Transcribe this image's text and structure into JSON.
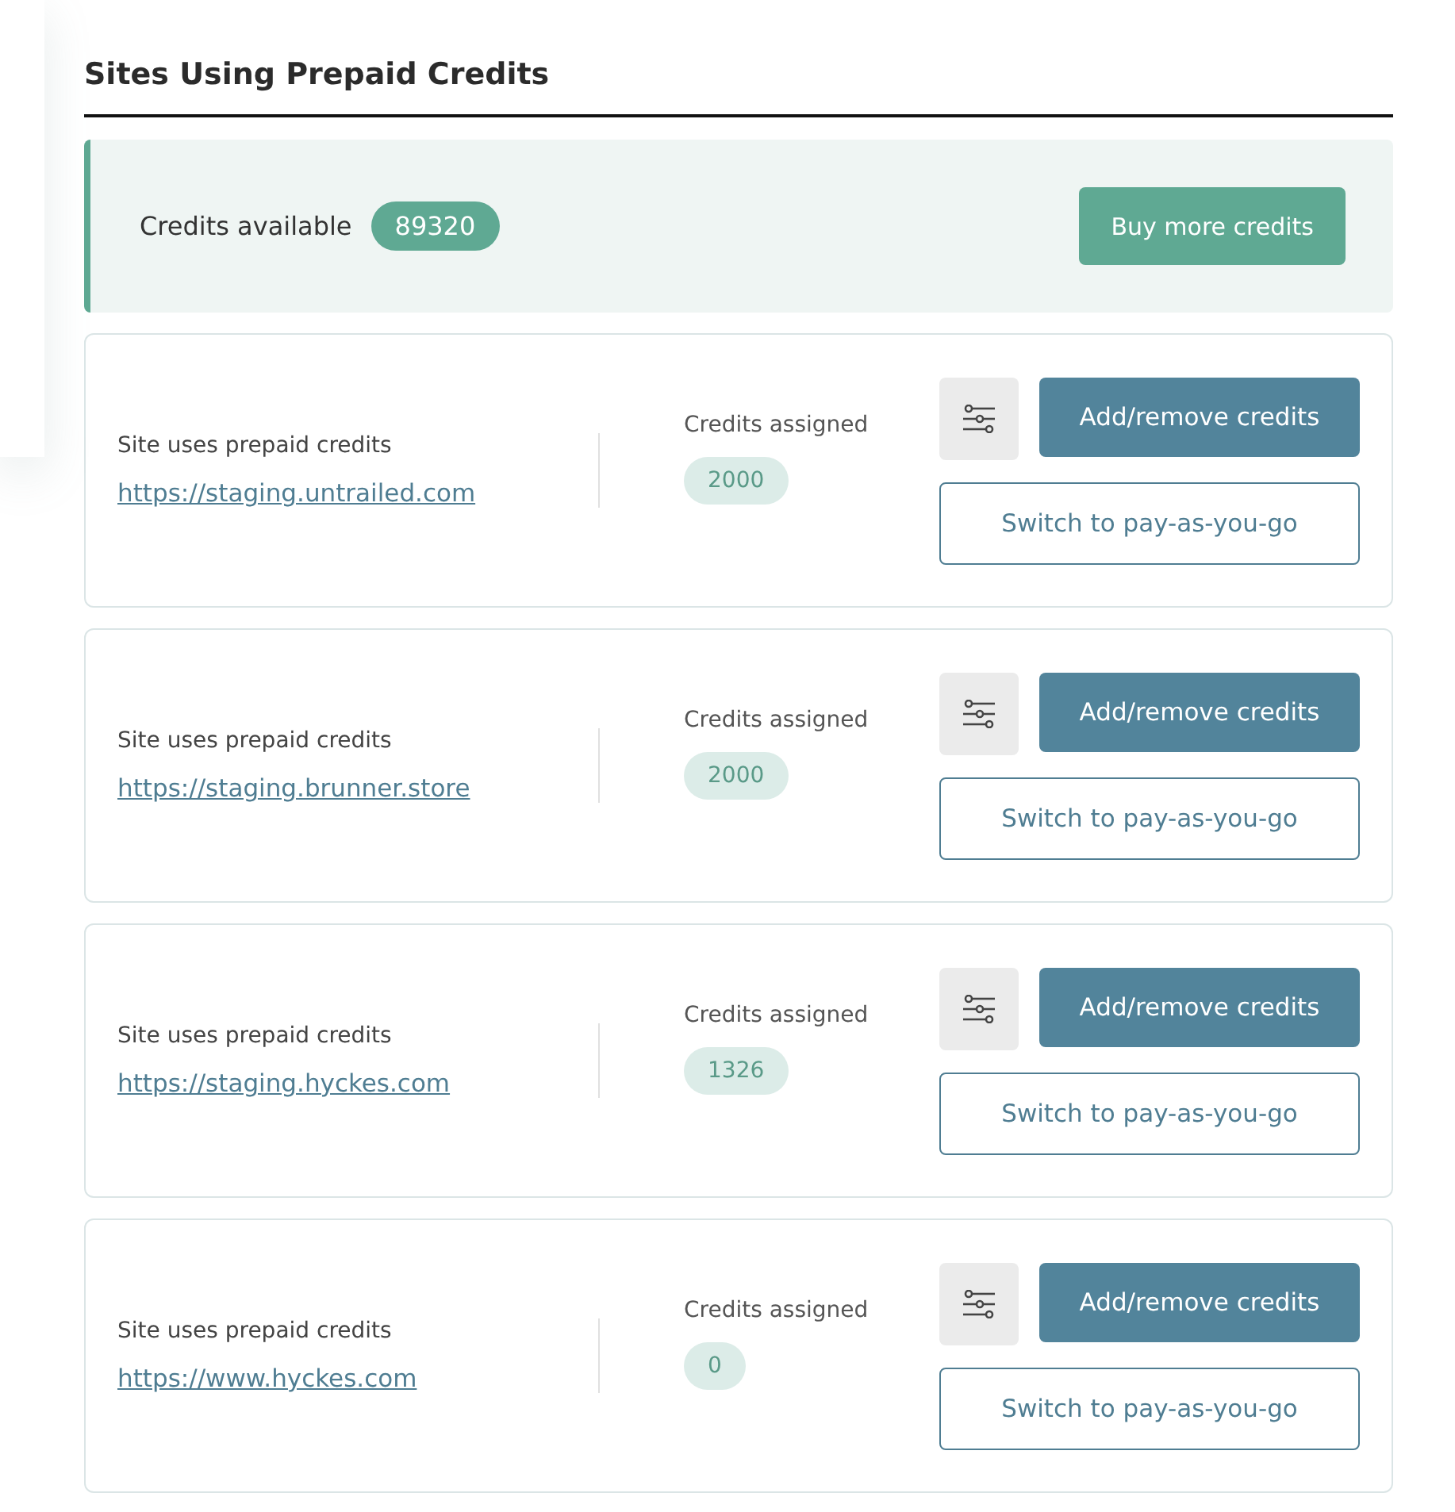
{
  "title": "Sites Using Prepaid Credits",
  "summary": {
    "label": "Credits available",
    "value": "89320",
    "button": "Buy more credits"
  },
  "sites": [
    {
      "status": "Site uses prepaid credits",
      "url": "https://staging.untrailed.com",
      "credits_label": "Credits assigned",
      "credits": "2000",
      "primary_button": "Add/remove credits",
      "secondary_button": "Switch to pay-as-you-go"
    },
    {
      "status": "Site uses prepaid credits",
      "url": "https://staging.brunner.store",
      "credits_label": "Credits assigned",
      "credits": "2000",
      "primary_button": "Add/remove credits",
      "secondary_button": "Switch to pay-as-you-go"
    },
    {
      "status": "Site uses prepaid credits",
      "url": "https://staging.hyckes.com",
      "credits_label": "Credits assigned",
      "credits": "1326",
      "primary_button": "Add/remove credits",
      "secondary_button": "Switch to pay-as-you-go"
    },
    {
      "status": "Site uses prepaid credits",
      "url": "https://www.hyckes.com",
      "credits_label": "Credits assigned",
      "credits": "0",
      "primary_button": "Add/remove credits",
      "secondary_button": "Switch to pay-as-you-go"
    }
  ]
}
